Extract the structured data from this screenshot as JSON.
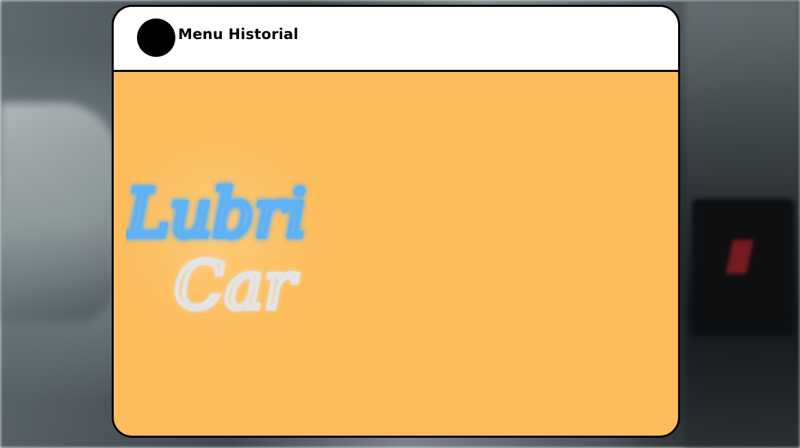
{
  "header": {
    "title": "Menu Historial"
  },
  "logo": {
    "line1": "Lubri",
    "line2": "Car"
  },
  "colors": {
    "panel": "#fdbd5d",
    "header": "#ffffff",
    "border": "#000000",
    "logo_line1": "#5fb2f5",
    "logo_line2": "#e4e4e4"
  }
}
